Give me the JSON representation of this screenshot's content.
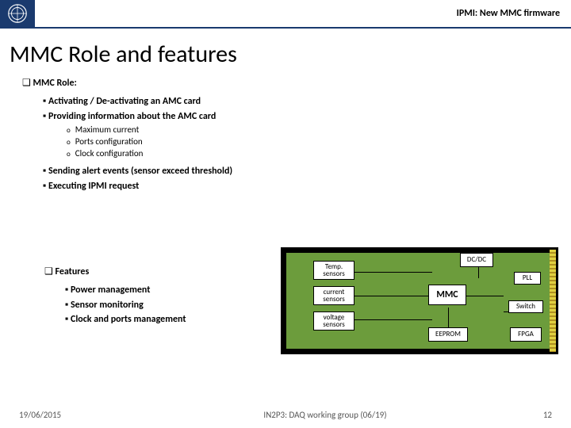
{
  "header": {
    "title": "IPMI: New MMC firmware"
  },
  "slide": {
    "title": "MMC Role and features"
  },
  "section1": {
    "heading": "MMC Role:",
    "items": [
      "Activating / De-activating an AMC card",
      "Providing information about the AMC card"
    ],
    "subitems": [
      "Maximum current",
      "Ports configuration",
      "Clock configuration"
    ],
    "items2": [
      "Sending alert events (sensor exceed threshold)",
      "Executing IPMI request"
    ]
  },
  "section2": {
    "heading": "Features",
    "items": [
      "Power management",
      "Sensor monitoring",
      "Clock and ports management"
    ]
  },
  "diagram": {
    "dcdc": "DC/DC",
    "temp": "Temp. sensors",
    "current": "current sensors",
    "voltage": "voltage sensors",
    "mmc": "MMC",
    "eeprom": "EEPROM",
    "pll": "PLL",
    "switch": "Switch",
    "fpga": "FPGA"
  },
  "footer": {
    "date": "19/06/2015",
    "center": "IN2P3: DAQ working group (06/19)",
    "page": "12"
  }
}
